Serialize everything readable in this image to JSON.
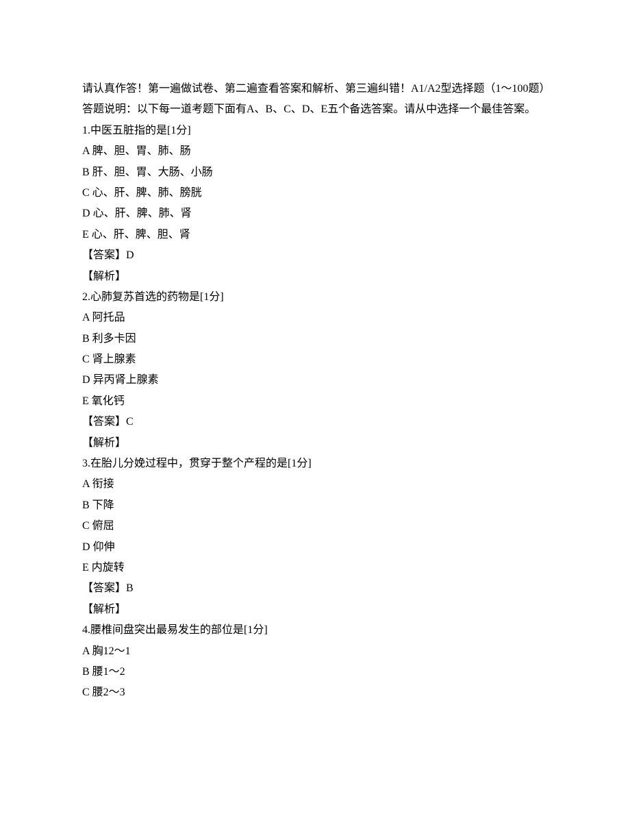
{
  "intro": "请认真作答！第一遍做试卷、第二遍查看答案和解析、第三遍纠错！A1/A2型选择题（1～100题）答题说明：以下每一道考题下面有A、B、C、D、E五个备选答案。请从中选择一个最佳答案。",
  "questions": [
    {
      "number": "1",
      "stem": "中医五脏指的是",
      "points": "[1分]",
      "options": [
        {
          "key": "A",
          "text": "脾、胆、胃、肺、肠"
        },
        {
          "key": "B",
          "text": "肝、胆、胃、大肠、小肠"
        },
        {
          "key": "C",
          "text": "心、肝、脾、肺、膀胱"
        },
        {
          "key": "D",
          "text": "心、肝、脾、肺、肾"
        },
        {
          "key": "E",
          "text": "心、肝、脾、胆、肾"
        }
      ],
      "answer_label": "【答案】",
      "answer": "D",
      "analysis_label": "【解析】",
      "analysis": ""
    },
    {
      "number": "2",
      "stem": "心肺复苏首选的药物是",
      "points": "[1分]",
      "options": [
        {
          "key": "A",
          "text": "阿托品"
        },
        {
          "key": "B",
          "text": "利多卡因"
        },
        {
          "key": "C",
          "text": "肾上腺素"
        },
        {
          "key": "D",
          "text": "异丙肾上腺素"
        },
        {
          "key": "E",
          "text": "氧化钙"
        }
      ],
      "answer_label": "【答案】",
      "answer": "C",
      "analysis_label": "【解析】",
      "analysis": ""
    },
    {
      "number": "3",
      "stem": "在胎儿分娩过程中，贯穿于整个产程的是",
      "points": "[1分]",
      "options": [
        {
          "key": "A",
          "text": "衔接"
        },
        {
          "key": "B",
          "text": "下降"
        },
        {
          "key": "C",
          "text": "俯屈"
        },
        {
          "key": "D",
          "text": "仰伸"
        },
        {
          "key": "E",
          "text": "内旋转"
        }
      ],
      "answer_label": "【答案】",
      "answer": "B",
      "analysis_label": "【解析】",
      "analysis": ""
    },
    {
      "number": "4",
      "stem": "腰椎间盘突出最易发生的部位是",
      "points": "[1分]",
      "options": [
        {
          "key": "A",
          "text": "胸12～1"
        },
        {
          "key": "B",
          "text": "腰1～2"
        },
        {
          "key": "C",
          "text": "腰2～3"
        }
      ],
      "answer_label": "",
      "answer": "",
      "analysis_label": "",
      "analysis": ""
    }
  ]
}
